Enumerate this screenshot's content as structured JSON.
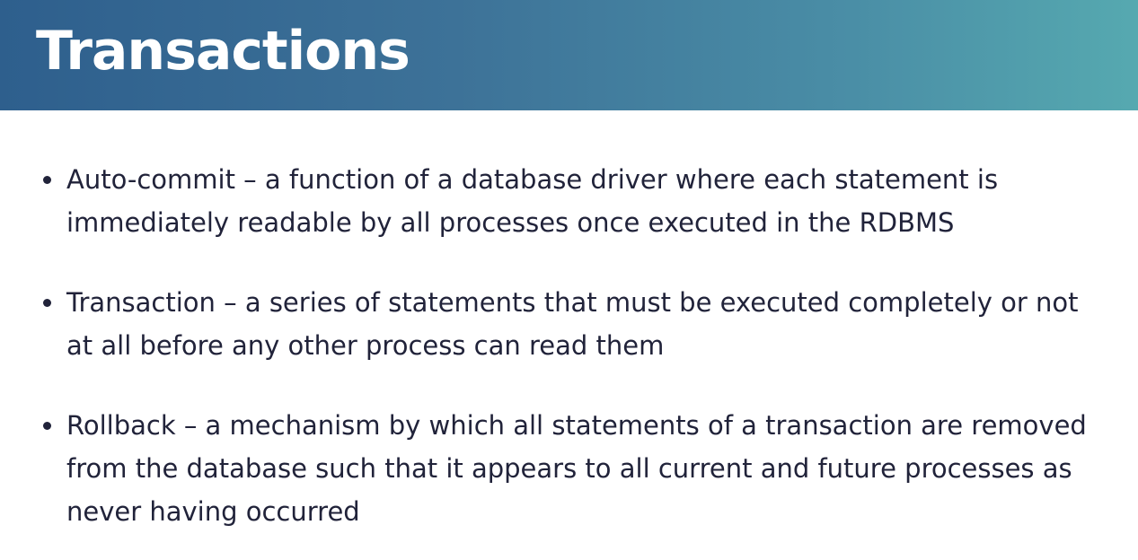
{
  "slide": {
    "title": "Transactions",
    "bullets": [
      {
        "lines": [
          "Auto-commit – a function of a database driver where each statement is",
          "immediately readable by all processes once executed in the RDBMS"
        ]
      },
      {
        "lines": [
          "Transaction – a series of statements that must be executed completely or not",
          "at all before any other process can read them"
        ]
      },
      {
        "lines": [
          "Rollback – a mechanism by which all statements of a transaction are removed",
          "from the database such that it appears to all current and future processes as",
          "never having occurred"
        ]
      }
    ]
  },
  "colors": {
    "header_gradient_start": "#2e5f8d",
    "header_gradient_end": "#56a9b0",
    "title_text": "#ffffff",
    "body_text": "#21233a",
    "background": "#ffffff"
  }
}
